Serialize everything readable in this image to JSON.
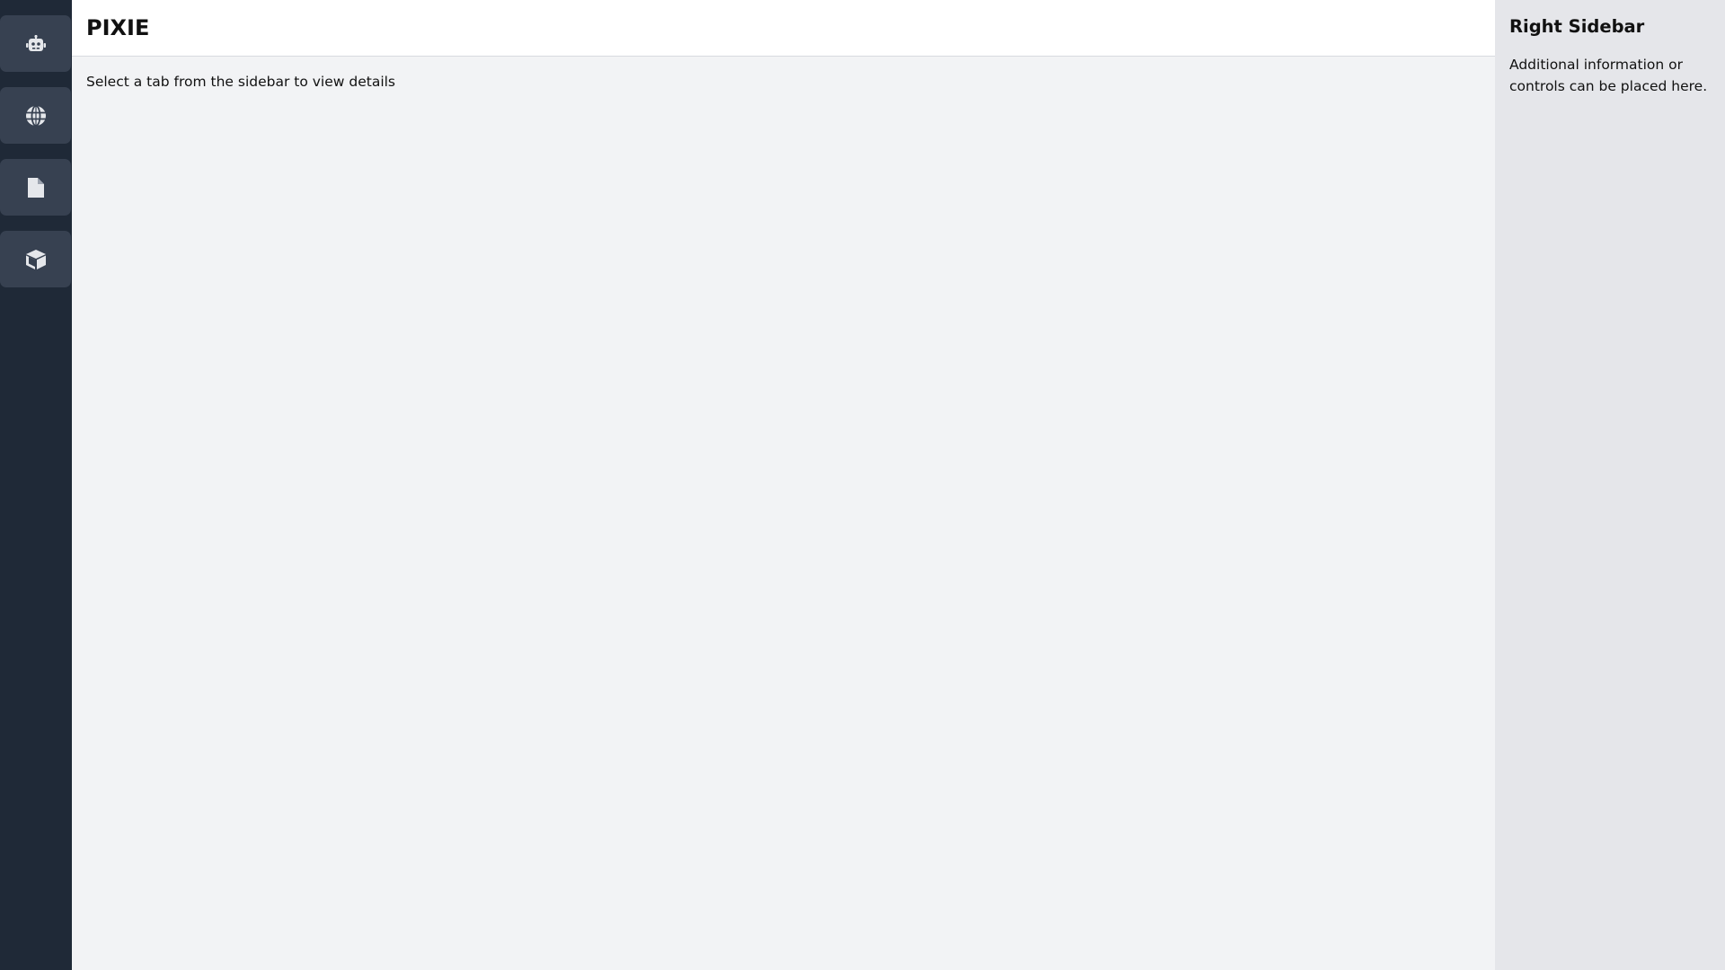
{
  "nav": {
    "items": [
      {
        "icon": "robot-icon"
      },
      {
        "icon": "globe-icon"
      },
      {
        "icon": "file-icon"
      },
      {
        "icon": "cube-icon"
      }
    ]
  },
  "header": {
    "title": "PIXIE"
  },
  "main": {
    "placeholder_text": "Select a tab from the sidebar to view details"
  },
  "right_sidebar": {
    "title": "Right Sidebar",
    "description": "Additional information or controls can be placed here."
  },
  "colors": {
    "nav_bg": "#1f2937",
    "nav_button_bg": "#374151",
    "icon_color": "#e5e7eb",
    "main_bg": "#f2f3f5",
    "header_bg": "#ffffff",
    "right_sidebar_bg": "#e5e6ea"
  }
}
